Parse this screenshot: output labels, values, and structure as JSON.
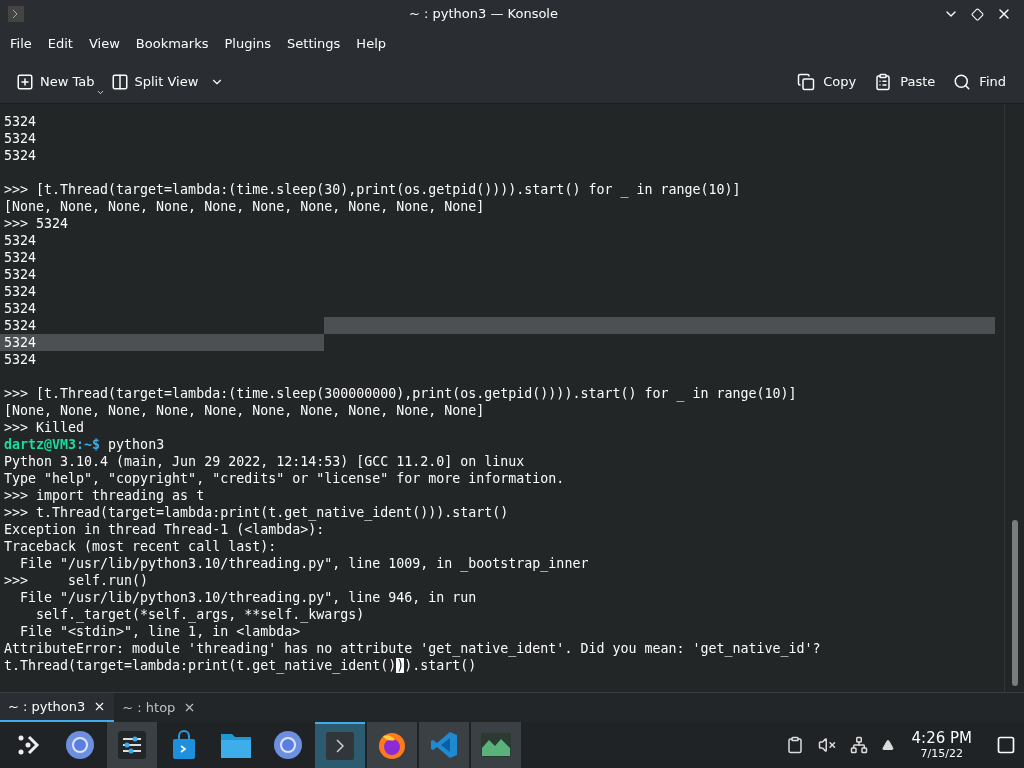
{
  "window": {
    "title": "~ : python3 — Konsole"
  },
  "menu": [
    "File",
    "Edit",
    "View",
    "Bookmarks",
    "Plugins",
    "Settings",
    "Help"
  ],
  "toolbar": {
    "left": [
      {
        "kind": "new_tab",
        "label": "New Tab"
      },
      {
        "kind": "split_view",
        "label": "Split View"
      }
    ],
    "right": [
      {
        "kind": "copy",
        "label": "Copy"
      },
      {
        "kind": "paste",
        "label": "Paste"
      },
      {
        "kind": "find",
        "label": "Find"
      }
    ]
  },
  "terminal": {
    "lines": [
      {
        "kind": "text",
        "text": "5324"
      },
      {
        "kind": "text",
        "text": "5324"
      },
      {
        "kind": "text",
        "text": "5324"
      },
      {
        "kind": "blank"
      },
      {
        "kind": "text",
        "text": ">>> [t.Thread(target=lambda:(time.sleep(30),print(os.getpid()))).start() for _ in range(10)]"
      },
      {
        "kind": "text",
        "text": "[None, None, None, None, None, None, None, None, None, None]"
      },
      {
        "kind": "text",
        "text": ">>> 5324"
      },
      {
        "kind": "text",
        "text": "5324"
      },
      {
        "kind": "text",
        "text": "5324"
      },
      {
        "kind": "text",
        "text": "5324"
      },
      {
        "kind": "text",
        "text": "5324"
      },
      {
        "kind": "text",
        "text": "5324"
      },
      {
        "kind": "selection_start",
        "text": "5324"
      },
      {
        "kind": "selection_end",
        "text": "5324"
      },
      {
        "kind": "text",
        "text": "5324"
      },
      {
        "kind": "blank"
      },
      {
        "kind": "text",
        "text": ">>> [t.Thread(target=lambda:(time.sleep(300000000),print(os.getpid()))).start() for _ in range(10)]"
      },
      {
        "kind": "text",
        "text": "[None, None, None, None, None, None, None, None, None, None]"
      },
      {
        "kind": "text",
        "text": ">>> Killed"
      },
      {
        "kind": "prompt",
        "user_host": "dartz@VM3",
        "path": ":~$",
        "command": " python3"
      },
      {
        "kind": "text",
        "text": "Python 3.10.4 (main, Jun 29 2022, 12:14:53) [GCC 11.2.0] on linux"
      },
      {
        "kind": "text",
        "text": "Type \"help\", \"copyright\", \"credits\" or \"license\" for more information."
      },
      {
        "kind": "text",
        "text": ">>> import threading as t"
      },
      {
        "kind": "text",
        "text": ">>> t.Thread(target=lambda:print(t.get_native_ident())).start()"
      },
      {
        "kind": "text",
        "text": "Exception in thread Thread-1 (<lambda>):"
      },
      {
        "kind": "text",
        "text": "Traceback (most recent call last):"
      },
      {
        "kind": "text",
        "text": "  File \"/usr/lib/python3.10/threading.py\", line 1009, in _bootstrap_inner"
      },
      {
        "kind": "text",
        "text": ">>>     self.run()"
      },
      {
        "kind": "text",
        "text": "  File \"/usr/lib/python3.10/threading.py\", line 946, in run"
      },
      {
        "kind": "text",
        "text": "    self._target(*self._args, **self._kwargs)"
      },
      {
        "kind": "text",
        "text": "  File \"<stdin>\", line 1, in <lambda>"
      },
      {
        "kind": "text",
        "text": "AttributeError: module 'threading' has no attribute 'get_native_ident'. Did you mean: 'get_native_id'?"
      },
      {
        "kind": "cursor",
        "before": "t.Thread(target=lambda:print(t.get_native_ident()",
        "cursor": ")",
        "after": ").start()"
      }
    ]
  },
  "tabs": [
    {
      "label": "~ : python3",
      "selected": true
    },
    {
      "label": "~ : htop",
      "selected": false
    }
  ],
  "taskbar": {
    "items": [
      {
        "kind": "launcher",
        "open": false,
        "active": false
      },
      {
        "kind": "browser",
        "open": false,
        "active": false
      },
      {
        "kind": "mixer",
        "open": true,
        "active": false
      },
      {
        "kind": "store",
        "open": false,
        "active": false
      },
      {
        "kind": "folder",
        "open": false,
        "active": false
      },
      {
        "kind": "browser",
        "open": false,
        "active": false
      },
      {
        "kind": "terminal",
        "active": true
      },
      {
        "kind": "firefox",
        "open": true,
        "active": false
      },
      {
        "kind": "code",
        "open": true,
        "active": false
      },
      {
        "kind": "monitor",
        "open": true,
        "active": false
      }
    ],
    "tray": [
      {
        "kind": "clipboard"
      },
      {
        "kind": "muted"
      },
      {
        "kind": "network"
      },
      {
        "kind": "arrow"
      }
    ],
    "time": "4:26 PM",
    "date": "7/15/22"
  }
}
